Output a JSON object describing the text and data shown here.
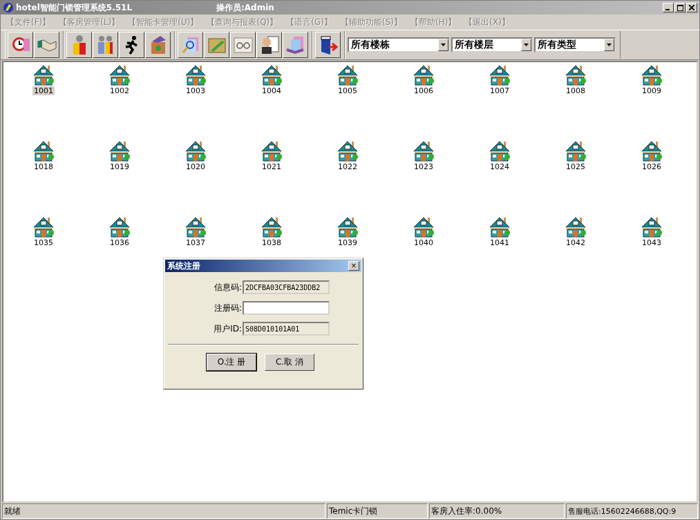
{
  "window": {
    "title": "hotel智能门锁管理系统5.51L",
    "operator": "操作员:Admin"
  },
  "menu": [
    "【文件(F)】",
    "【客房管理(L)】",
    "【智能卡管理(U)】",
    "【查询与报表(Q)】",
    "【语言(G)】",
    "【辅助功能(S)】",
    "【帮助(H)】",
    "【退出(X)】"
  ],
  "filters": [
    {
      "value": "所有楼栋"
    },
    {
      "value": "所有楼层"
    },
    {
      "value": "所有类型"
    }
  ],
  "rooms": [
    {
      "number": "1001",
      "selected": true
    },
    {
      "number": "1002",
      "selected": false
    },
    {
      "number": "1003",
      "selected": false
    },
    {
      "number": "1004",
      "selected": false
    },
    {
      "number": "1005",
      "selected": false
    },
    {
      "number": "1006",
      "selected": false
    },
    {
      "number": "1007",
      "selected": false
    },
    {
      "number": "1008",
      "selected": false
    },
    {
      "number": "1009",
      "selected": false
    },
    {
      "number": "1018",
      "selected": false
    },
    {
      "number": "1019",
      "selected": false
    },
    {
      "number": "1020",
      "selected": false
    },
    {
      "number": "1021",
      "selected": false
    },
    {
      "number": "1022",
      "selected": false
    },
    {
      "number": "1023",
      "selected": false
    },
    {
      "number": "1024",
      "selected": false
    },
    {
      "number": "1025",
      "selected": false
    },
    {
      "number": "1026",
      "selected": false
    },
    {
      "number": "1035",
      "selected": false
    },
    {
      "number": "1036",
      "selected": false
    },
    {
      "number": "1037",
      "selected": false
    },
    {
      "number": "1038",
      "selected": false
    },
    {
      "number": "1039",
      "selected": false
    },
    {
      "number": "1040",
      "selected": false
    },
    {
      "number": "1041",
      "selected": false
    },
    {
      "number": "1042",
      "selected": false
    },
    {
      "number": "1043",
      "selected": false
    }
  ],
  "dialog": {
    "title": "系统注册",
    "close": "×",
    "fields": [
      {
        "label": "信息码:",
        "value": "2DCFBA03CFBA23DDB2",
        "disabled": true
      },
      {
        "label": "注册码:",
        "disabled": false
      },
      {
        "label": "用户ID:",
        "value": "S08D010101A01",
        "disabled": true
      }
    ],
    "buttons": [
      "O.注 册",
      "C.取 消"
    ]
  },
  "status_bar": [
    "就绪",
    "Temic卡门锁",
    "客房入住率:0.00%",
    "售服电话:15602246688,QQ:9"
  ]
}
